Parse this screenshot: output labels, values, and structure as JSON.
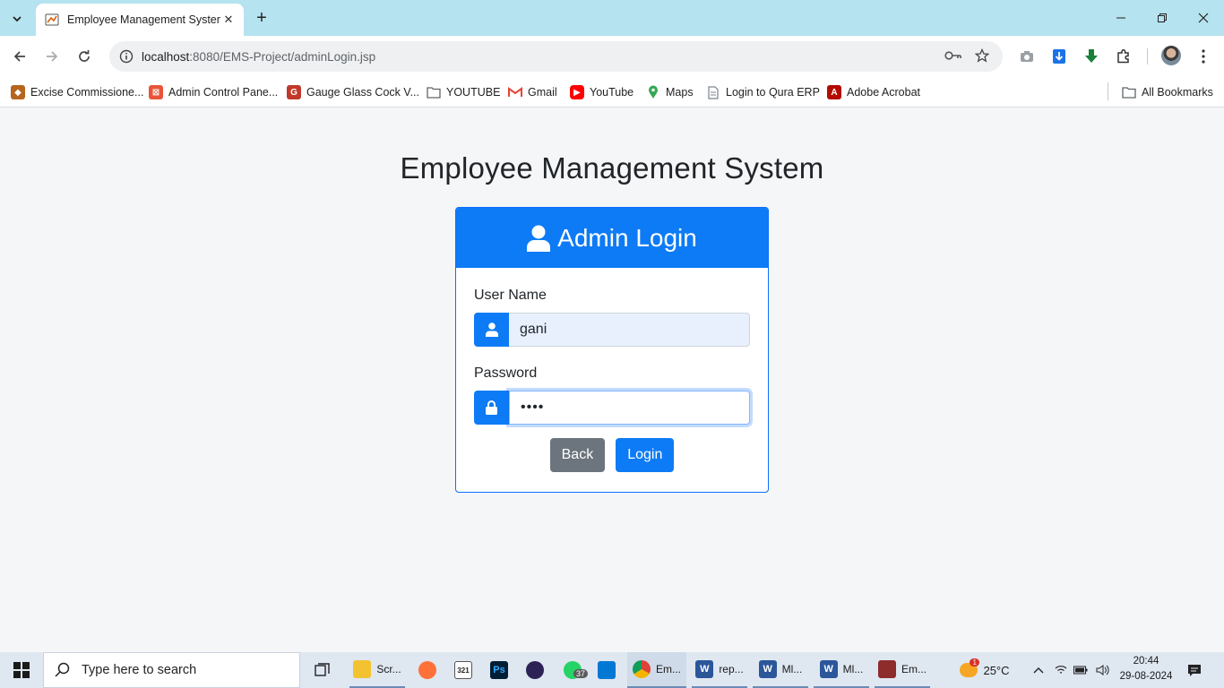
{
  "browser": {
    "tab_title": "Employee Management System",
    "url_host": "localhost",
    "url_path": ":8080/EMS-Project/adminLogin.jsp",
    "bookmarks": [
      {
        "label": "Excise Commissione...",
        "icon": "excise-icon",
        "color": "#b5651d"
      },
      {
        "label": "Admin Control Pane...",
        "icon": "admin-panel-icon",
        "color": "#e8553b"
      },
      {
        "label": "Gauge Glass Cock V...",
        "icon": "gauge-icon",
        "color": "#c0392b"
      },
      {
        "label": "YOUTUBE",
        "icon": "folder-icon",
        "color": "#5f6368"
      },
      {
        "label": "Gmail",
        "icon": "gmail-icon",
        "color": "#ea4335"
      },
      {
        "label": "YouTube",
        "icon": "youtube-icon",
        "color": "#ff0000"
      },
      {
        "label": "Maps",
        "icon": "maps-icon",
        "color": "#34a853"
      },
      {
        "label": "Login to Qura ERP",
        "icon": "document-icon",
        "color": "#7a8290"
      },
      {
        "label": "Adobe Acrobat",
        "icon": "acrobat-icon",
        "color": "#b30b00"
      }
    ],
    "all_bookmarks": "All Bookmarks"
  },
  "page": {
    "title": "Employee Management System",
    "card_title": "Admin Login",
    "username_label": "User Name",
    "username_value": "gani",
    "password_label": "Password",
    "password_value": "••••",
    "back_label": "Back",
    "login_label": "Login",
    "accent": "#0d7bf5",
    "back_color": "#6c757d"
  },
  "taskbar": {
    "search_placeholder": "Type here to search",
    "apps": [
      {
        "label": "Scr...",
        "icon": "file-explorer-icon"
      },
      {
        "label": "",
        "icon": "firefox-icon"
      },
      {
        "label": "",
        "icon": "calendar-icon"
      },
      {
        "label": "",
        "icon": "photoshop-icon"
      },
      {
        "label": "",
        "icon": "eclipse-icon"
      },
      {
        "label": "",
        "icon": "whatsapp-icon",
        "badge": "37"
      },
      {
        "label": "",
        "icon": "vscode-icon"
      },
      {
        "label": "Em...",
        "icon": "chrome-icon"
      },
      {
        "label": "rep...",
        "icon": "word-icon"
      },
      {
        "label": "Ml...",
        "icon": "word-icon"
      },
      {
        "label": "Ml...",
        "icon": "word-icon"
      },
      {
        "label": "Em...",
        "icon": "app-icon"
      }
    ],
    "calendar_day": "321",
    "weather_badge": "1",
    "temperature": "25°C",
    "time": "20:44",
    "date": "29-08-2024"
  }
}
